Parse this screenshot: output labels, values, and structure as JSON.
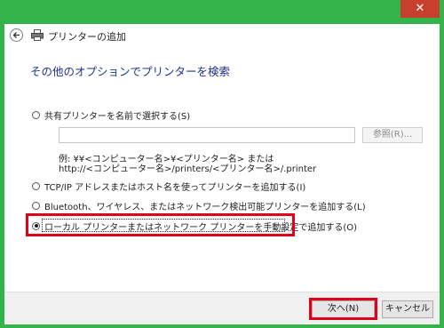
{
  "window": {
    "title": "プリンターの追加",
    "close_glyph": "✕"
  },
  "main": {
    "heading": "その他のオプションでプリンターを検索",
    "options": [
      {
        "label": "共有プリンターを名前で選択する(S)",
        "checked": false
      },
      {
        "label": "TCP/IP アドレスまたはホスト名を使ってプリンターを追加する(I)",
        "checked": false
      },
      {
        "label": "Bluetooth、ワイヤレス、またはネットワーク検出可能プリンターを追加する(L)",
        "checked": false
      },
      {
        "label": "ローカル プリンターまたはネットワーク プリンターを手動設定で追加する(O)",
        "checked": true
      }
    ],
    "path_input_value": "",
    "browse_label": "参照(R)...",
    "example_line1": "例: ¥¥<コンピューター名>¥<プリンター名> または",
    "example_line2": "http://<コンピューター名>/printers/<プリンター名>/.printer"
  },
  "footer": {
    "next_label": "次へ(N)",
    "cancel_label": "キャンセル"
  },
  "colors": {
    "frame": "#34b34a",
    "close": "#c7402d",
    "heading": "#1e3287",
    "highlight": "#e0001b"
  },
  "icons": [
    "back-arrow-icon",
    "printer-icon",
    "close-icon"
  ]
}
